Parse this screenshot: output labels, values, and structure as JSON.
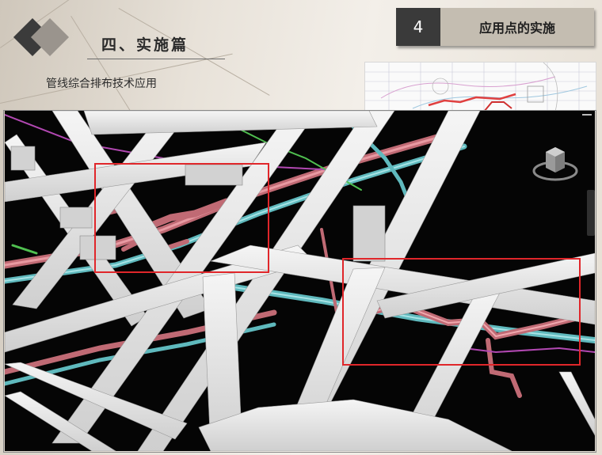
{
  "slide": {
    "section_title": "四、实施篇",
    "subtitle": "管线综合排布技术应用"
  },
  "tag": {
    "number": "4",
    "label": "应用点的实施"
  },
  "colors": {
    "tag_dark": "#3a3a3a",
    "tag_light": "#c4bdb1",
    "highlight_box": "#e0262a",
    "beam": "#e4e4e4",
    "pipe_red": "#d0707a",
    "pipe_cyan": "#6ec8cc",
    "pipe_magenta": "#c050c0",
    "pipe_green": "#50c050"
  },
  "viewport": {
    "content": "3D BIM model of ceiling beams with MEP pipelines",
    "highlight_regions": 2
  },
  "icons": [
    "diamond-icon",
    "viewcube-icon",
    "navigation-bar-icon"
  ]
}
